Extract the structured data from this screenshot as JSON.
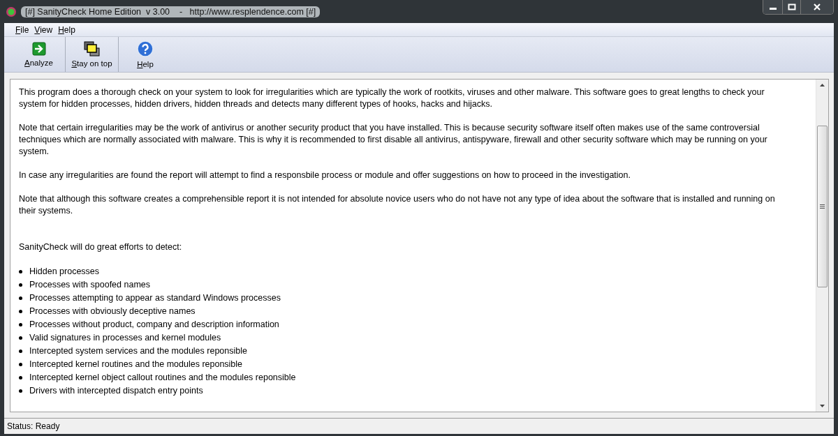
{
  "window": {
    "title": "[#] SanityCheck Home Edition  v 3.00    -   http://www.resplendence.com [#]"
  },
  "menu": [
    {
      "label": "File"
    },
    {
      "label": "View"
    },
    {
      "label": "Help"
    }
  ],
  "toolbar": [
    {
      "label": "Analyze",
      "kind": "analyze"
    },
    {
      "label": "Stay on top",
      "kind": "ontop"
    },
    {
      "label": "Help",
      "kind": "help"
    }
  ],
  "content": {
    "paragraphs": [
      "This program does a thorough check on your system to look for irregularities which are typically the work of rootkits, viruses and other malware. This software goes to great lengths to check your system for hidden processes, hidden drivers, hidden threads and detects many different types of hooks, hacks and hijacks.",
      "Note that certain irregularities may be the work of antivirus or another security product that you have installed. This is because security software itself often makes use of the same controversial techniques which are normally associated with malware. This is why it is recommended to first disable all antivirus, antispyware, firewall and other security software which may be running on your system.",
      "In case any irregularities are found the report will attempt to find a responsbile process or module and offer suggestions on how to proceed in the investigation.",
      "Note that although this software creates a comprehensible report it is not intended for absolute novice users who do not have not any type of idea about the software that is installed and running on their systems."
    ],
    "intro": "SanityCheck will do great efforts to detect:",
    "bullets": [
      "Hidden processes",
      "Processes with spoofed names",
      "Processes attempting to appear as standard Windows processes",
      "Processes with obviously deceptive names",
      "Processes without product, company and description information",
      "Valid signatures in processes and kernel modules",
      "Intercepted system services and the modules reponsible",
      "Intercepted kernel routines and the modules reponsible",
      "Intercepted kernel object callout routines and the modules reponsible",
      "Drivers with intercepted dispatch entry points"
    ]
  },
  "status_bar": "Status: Ready"
}
